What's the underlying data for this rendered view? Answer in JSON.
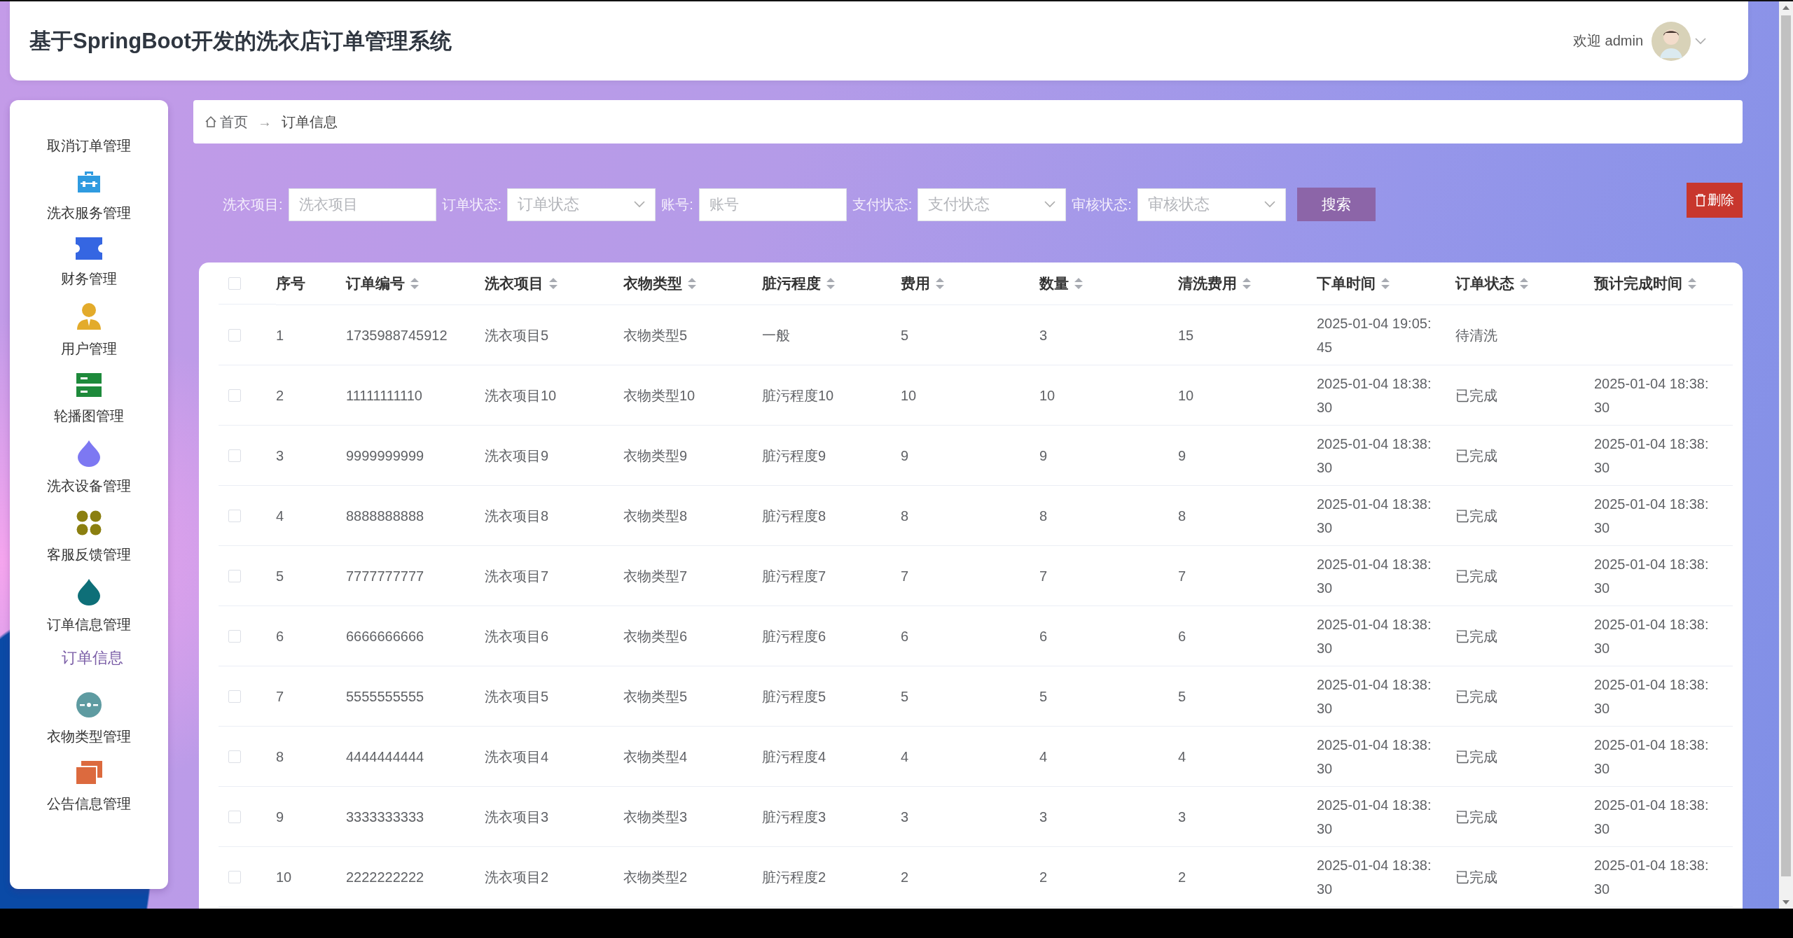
{
  "header": {
    "title": "基于SpringBoot开发的洗衣店订单管理系统",
    "welcome": "欢迎 admin"
  },
  "sidebar": {
    "items": [
      {
        "label": "取消订单管理"
      },
      {
        "label": "洗衣服务管理"
      },
      {
        "label": "财务管理"
      },
      {
        "label": "用户管理"
      },
      {
        "label": "轮播图管理"
      },
      {
        "label": "洗衣设备管理"
      },
      {
        "label": "客服反馈管理"
      },
      {
        "label": "订单信息管理",
        "children": [
          {
            "label": "订单信息",
            "selected": true
          }
        ]
      },
      {
        "label": "衣物类型管理"
      },
      {
        "label": "公告信息管理"
      }
    ]
  },
  "breadcrumb": {
    "items": [
      "首页",
      "订单信息"
    ],
    "separator": "→"
  },
  "filters": [
    {
      "kind": "input",
      "label": "洗衣项目:",
      "placeholder": "洗衣项目"
    },
    {
      "kind": "select",
      "label": "订单状态:",
      "placeholder": "订单状态"
    },
    {
      "kind": "input",
      "label": "账号:",
      "placeholder": "账号"
    },
    {
      "kind": "select",
      "label": "支付状态:",
      "placeholder": "支付状态"
    },
    {
      "kind": "select",
      "label": "审核状态:",
      "placeholder": "审核状态"
    }
  ],
  "search_button": "搜索",
  "delete_button": "删除",
  "table": {
    "all_checked": false,
    "columns": [
      {
        "label": "序号",
        "sortable": false
      },
      {
        "label": "订单编号",
        "sortable": true
      },
      {
        "label": "洗衣项目",
        "sortable": true
      },
      {
        "label": "衣物类型",
        "sortable": true
      },
      {
        "label": "脏污程度",
        "sortable": true
      },
      {
        "label": "费用",
        "sortable": true
      },
      {
        "label": "数量",
        "sortable": true
      },
      {
        "label": "清洗费用",
        "sortable": true
      },
      {
        "label": "下单时间",
        "sortable": true
      },
      {
        "label": "订单状态",
        "sortable": true
      },
      {
        "label": "预计完成时间",
        "sortable": true
      }
    ],
    "rows": [
      {
        "checked": false,
        "cells": [
          "1",
          "1735988745912",
          "洗衣项目5",
          "衣物类型5",
          "一般",
          "5",
          "3",
          "15",
          "2025-01-04 19:05:45",
          "待清洗"
        ]
      },
      {
        "checked": false,
        "cells": [
          "2",
          "11111111110",
          "洗衣项目10",
          "衣物类型10",
          "脏污程度10",
          "10",
          "10",
          "10",
          "2025-01-04 18:38:30",
          "已完成",
          "2025-01-04 18:38:30"
        ]
      },
      {
        "checked": false,
        "cells": [
          "3",
          "9999999999",
          "洗衣项目9",
          "衣物类型9",
          "脏污程度9",
          "9",
          "9",
          "9",
          "2025-01-04 18:38:30",
          "已完成",
          "2025-01-04 18:38:30"
        ]
      },
      {
        "checked": false,
        "cells": [
          "4",
          "8888888888",
          "洗衣项目8",
          "衣物类型8",
          "脏污程度8",
          "8",
          "8",
          "8",
          "2025-01-04 18:38:30",
          "已完成",
          "2025-01-04 18:38:30"
        ]
      },
      {
        "checked": false,
        "cells": [
          "5",
          "7777777777",
          "洗衣项目7",
          "衣物类型7",
          "脏污程度7",
          "7",
          "7",
          "7",
          "2025-01-04 18:38:30",
          "已完成",
          "2025-01-04 18:38:30"
        ]
      },
      {
        "checked": false,
        "cells": [
          "6",
          "6666666666",
          "洗衣项目6",
          "衣物类型6",
          "脏污程度6",
          "6",
          "6",
          "6",
          "2025-01-04 18:38:30",
          "已完成",
          "2025-01-04 18:38:30"
        ]
      },
      {
        "checked": false,
        "cells": [
          "7",
          "5555555555",
          "洗衣项目5",
          "衣物类型5",
          "脏污程度5",
          "5",
          "5",
          "5",
          "2025-01-04 18:38:30",
          "已完成",
          "2025-01-04 18:38:30"
        ]
      },
      {
        "checked": false,
        "cells": [
          "8",
          "4444444444",
          "洗衣项目4",
          "衣物类型4",
          "脏污程度4",
          "4",
          "4",
          "4",
          "2025-01-04 18:38:30",
          "已完成",
          "2025-01-04 18:38:30"
        ]
      },
      {
        "checked": false,
        "cells": [
          "9",
          "3333333333",
          "洗衣项目3",
          "衣物类型3",
          "脏污程度3",
          "3",
          "3",
          "3",
          "2025-01-04 18:38:30",
          "已完成",
          "2025-01-04 18:38:30"
        ]
      },
      {
        "checked": false,
        "cells": [
          "10",
          "2222222222",
          "洗衣项目2",
          "衣物类型2",
          "脏污程度2",
          "2",
          "2",
          "2",
          "2025-01-04 18:38:30",
          "已完成",
          "2025-01-04 18:38:30"
        ]
      }
    ]
  }
}
